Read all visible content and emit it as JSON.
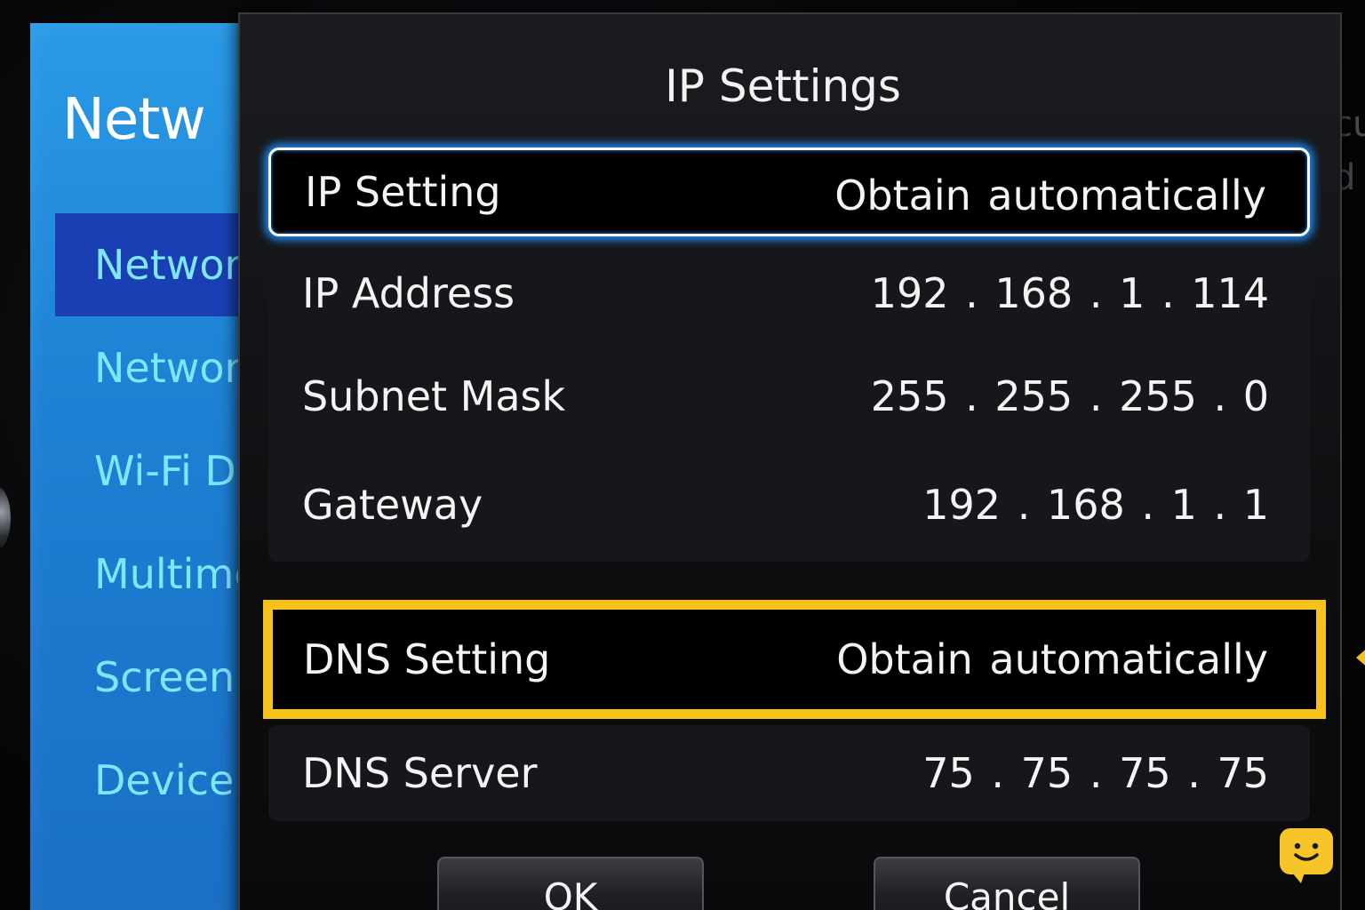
{
  "background_menu": {
    "title": "Netw",
    "items": [
      {
        "label": "Networ",
        "selected": true
      },
      {
        "label": "Networ",
        "selected": false
      },
      {
        "label": "Wi-Fi Di",
        "selected": false
      },
      {
        "label": "Multime",
        "selected": false
      },
      {
        "label": "Screen",
        "selected": false
      },
      {
        "label": "Device I",
        "selected": false
      }
    ],
    "right_fragments": [
      "cu",
      "d"
    ]
  },
  "dialog": {
    "title": "IP Settings",
    "rows": {
      "ip_setting": {
        "label": "IP Setting",
        "value": "Obtain automatically"
      },
      "ip_address": {
        "label": "IP Address",
        "value": "192 . 168 . 1 . 114"
      },
      "subnet_mask": {
        "label": "Subnet Mask",
        "value": "255 . 255 . 255 . 0"
      },
      "gateway": {
        "label": "Gateway",
        "value": "192 . 168 . 1 . 1"
      },
      "dns_setting": {
        "label": "DNS Setting",
        "value": "Obtain automatically"
      },
      "dns_server": {
        "label": "DNS Server",
        "value": "75 . 75 . 75 . 75"
      }
    },
    "buttons": {
      "ok": "OK",
      "cancel": "Cancel"
    }
  },
  "colors": {
    "menu_blue": "#1d7fd3",
    "menu_text_cyan": "#7fe6ff",
    "focus_glow_blue": "#1e8fff",
    "highlight_yellow": "#f7c21b"
  },
  "icons": {
    "chat": "chat-bubble-smile-icon",
    "arrow": "arrow-left-icon"
  }
}
